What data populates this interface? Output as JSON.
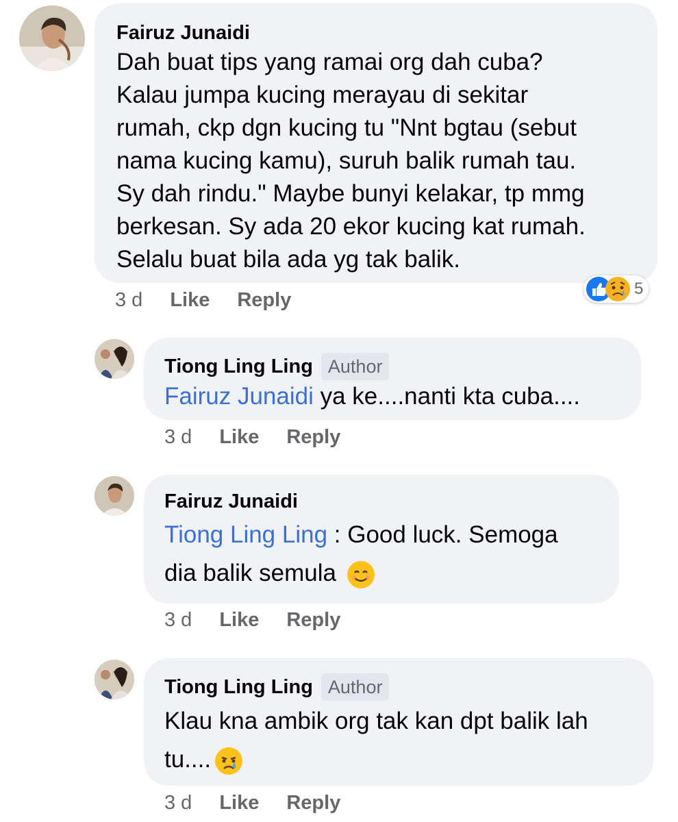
{
  "comments": [
    {
      "author": "Fairuz Junaidi",
      "badge": "",
      "mention": "",
      "text": "Dah buat tips yang ramai org dah cuba?\nKalau jumpa kucing merayau di sekitar\nrumah, ckp dgn kucing tu \"Nnt bgtau (sebut\nnama kucing kamu), suruh balik rumah tau.\nSy dah rindu.\" Maybe bunyi kelakar, tp mmg\nberkesan. Sy ada 20 ekor kucing kat rumah.\nSelalu buat bila ada yg tak balik.",
      "time": "3 d",
      "like_label": "Like",
      "reply_label": "Reply",
      "reaction_count": "5"
    },
    {
      "author": "Tiong Ling Ling",
      "badge": "Author",
      "mention": "Fairuz Junaidi",
      "text": " ya ke....nanti kta cuba....",
      "time": "3 d",
      "like_label": "Like",
      "reply_label": "Reply"
    },
    {
      "author": "Fairuz Junaidi",
      "badge": "",
      "mention": "Tiong Ling Ling",
      "text": " : Good luck. Semoga\ndia balik semula ",
      "time": "3 d",
      "like_label": "Like",
      "reply_label": "Reply"
    },
    {
      "author": "Tiong Ling Ling",
      "badge": "Author",
      "mention": "",
      "text": "Klau kna ambik org tak kan dpt balik lah\ntu....",
      "time": "3 d",
      "like_label": "Like",
      "reply_label": "Reply"
    }
  ],
  "icons": {
    "reaction_like": "like-reaction-icon",
    "reaction_sad": "sad-reaction-icon",
    "emoji_smile": "smiling-face-emoji",
    "emoji_cry": "crying-face-emoji"
  },
  "colors": {
    "bubble": "#f0f2f5",
    "mention": "#3a6fd8",
    "meta_text": "#65676b",
    "like_blue": "#1877f2",
    "sad_yellow": "#f7b125"
  }
}
